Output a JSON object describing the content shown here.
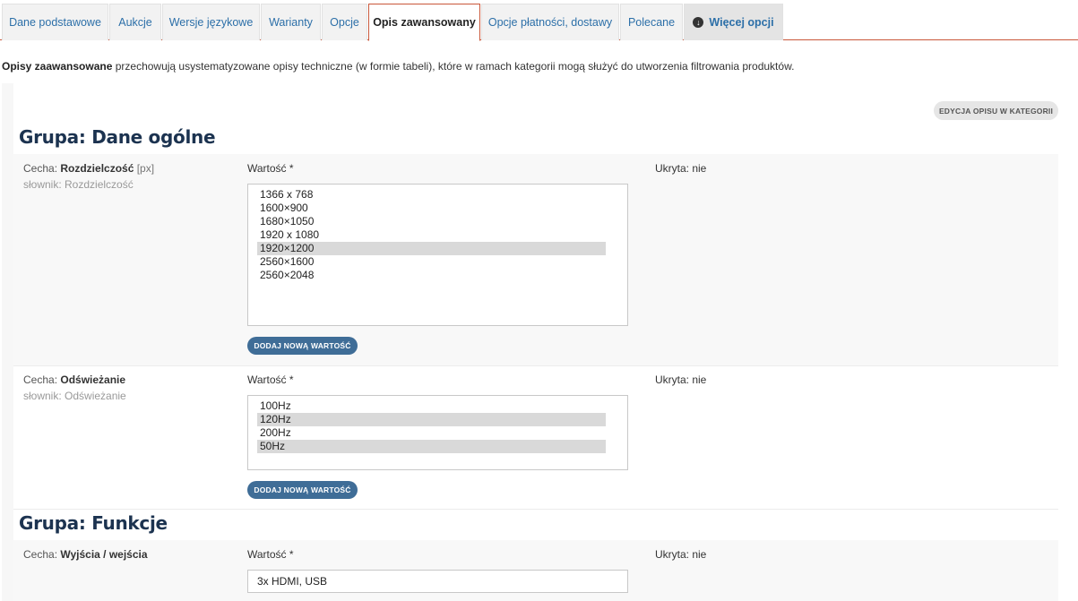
{
  "tabs": [
    {
      "label": "Dane podstawowe"
    },
    {
      "label": "Aukcje"
    },
    {
      "label": "Wersje językowe"
    },
    {
      "label": "Warianty"
    },
    {
      "label": "Opcje"
    },
    {
      "label": "Opis zawansowany"
    },
    {
      "label": "Opcje płatności, dostawy"
    },
    {
      "label": "Polecane"
    },
    {
      "label": "Więcej opcji"
    }
  ],
  "active_tab": "Opis zawansowany",
  "intro": {
    "bold": "Opisy zaawansowane",
    "text": " przechowują usystematyzowane opisy techniczne (w formie tabeli), które w ramach kategorii mogą służyć do utworzenia filtrowania produktów."
  },
  "edit_button": "EDYCJA OPISU W KATEGORII",
  "groups": [
    {
      "title": "Grupa: Dane ogólne",
      "features": [
        {
          "prefix": "Cecha: ",
          "name": "Rozdzielczość",
          "unit": " [px]",
          "dict": "słownik: Rozdzielczość",
          "value_label": "Wartość *",
          "hidden": "Ukryta: nie",
          "options": [
            "1366 x 768",
            "1600×900",
            "1680×1050",
            "1920 x 1080",
            "1920×1200",
            "2560×1600",
            "2560×2048"
          ],
          "selected": [
            "1920×1200"
          ],
          "add_button": "DODAJ NOWĄ WARTOŚĆ"
        },
        {
          "prefix": "Cecha: ",
          "name": "Odświeżanie",
          "dict": "słownik: Odświeżanie",
          "value_label": "Wartość *",
          "hidden": "Ukryta: nie",
          "options": [
            "100Hz",
            "120Hz",
            "200Hz",
            "50Hz"
          ],
          "selected": [
            "120Hz",
            "50Hz"
          ],
          "add_button": "DODAJ NOWĄ WARTOŚĆ"
        }
      ]
    },
    {
      "title": "Grupa: Funkcje",
      "features": [
        {
          "prefix": "Cecha: ",
          "name": "Wyjścia / wejścia",
          "value_label": "Wartość *",
          "hidden": "Ukryta: nie",
          "value": "3x HDMI, USB"
        }
      ]
    }
  ]
}
